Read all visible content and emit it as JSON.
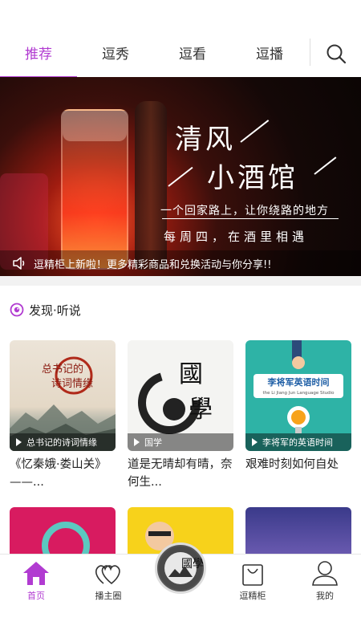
{
  "tabs": [
    {
      "label": "推荐",
      "active": true
    },
    {
      "label": "逗秀",
      "active": false
    },
    {
      "label": "逗看",
      "active": false
    },
    {
      "label": "逗播",
      "active": false
    }
  ],
  "search": {
    "icon": "search-icon"
  },
  "banner": {
    "title_line1": "清风",
    "title_line2": "小酒馆",
    "subtitle": "一个回家路上，让你绕路的地方",
    "tagline": "每周四，在酒里相遇",
    "notice_text": "逗精柜上新啦！更多精彩商品和兑换活动与你分享!!",
    "notice_icon": "speaker-icon"
  },
  "section": {
    "title": "发现·听说",
    "icon": "eye-icon"
  },
  "cards": [
    {
      "tag": "总书记的诗词情缘",
      "title": "《忆秦娥·娄山关》——...",
      "art_text": "总书记的诗词情缘"
    },
    {
      "tag": "国学",
      "title": "道是无晴却有晴，奈何生...",
      "art_text": "國學"
    },
    {
      "tag": "李将军的英语时间",
      "title": "艰难时刻如何自处",
      "art_text": "李将军英语时间",
      "art_sub": "the Li Jiang Jun Language Studio"
    }
  ],
  "center_art": "國學",
  "bottom_nav": [
    {
      "label": "首页",
      "icon": "home-icon",
      "active": true
    },
    {
      "label": "播主圈",
      "icon": "hearts-icon",
      "active": false
    },
    {
      "label": "逗精柜",
      "icon": "shopping-bag-icon",
      "active": false
    },
    {
      "label": "我的",
      "icon": "user-icon",
      "active": false
    }
  ],
  "colors": {
    "accent": "#b13bd1",
    "teal": "#2eb3a6"
  }
}
